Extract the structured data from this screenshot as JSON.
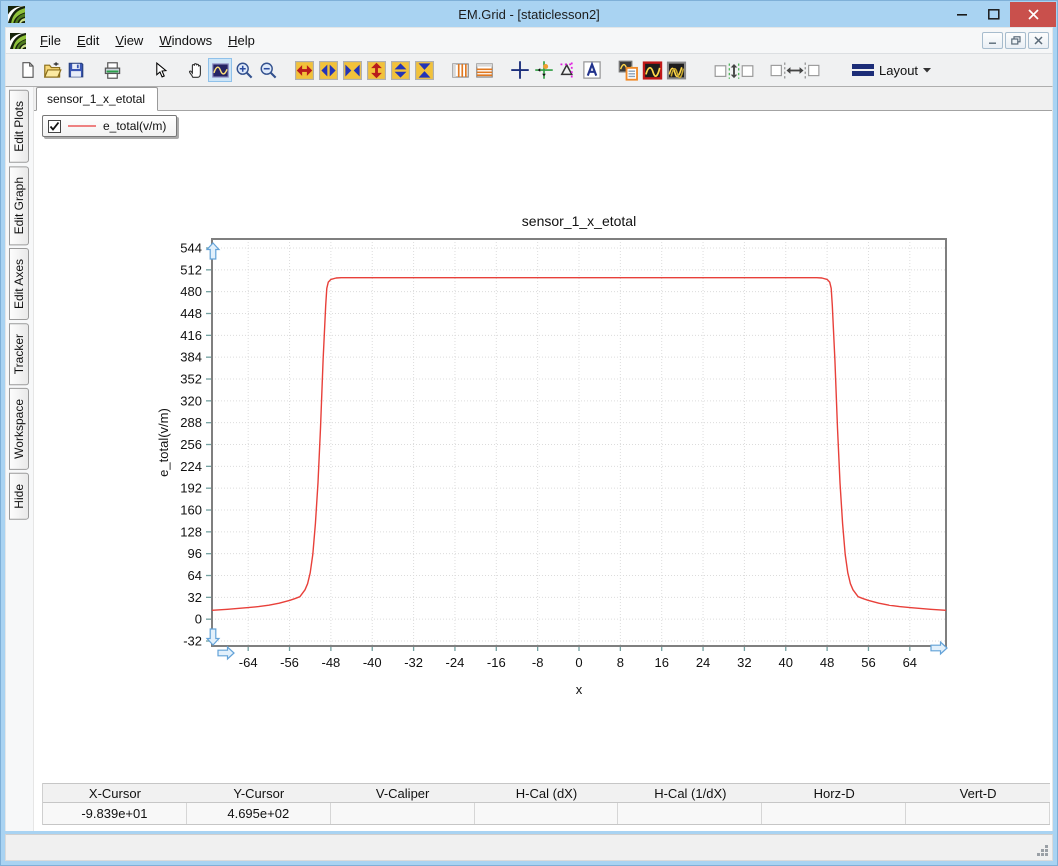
{
  "window": {
    "title": "EM.Grid - [staticlesson2]"
  },
  "menu": {
    "items": [
      "File",
      "Edit",
      "View",
      "Windows",
      "Help"
    ]
  },
  "toolbar": {
    "layout_label": "Layout"
  },
  "sidebar": {
    "tabs": [
      "Edit Plots",
      "Edit Graph",
      "Edit Axes",
      "Tracker",
      "Workspace",
      "Hide"
    ]
  },
  "document": {
    "tab_label": "sensor_1_x_etotal"
  },
  "legend": {
    "checked": true,
    "label": "e_total(v/m)",
    "sample_color": "#ee8181"
  },
  "status_table": {
    "columns": [
      "X-Cursor",
      "Y-Cursor",
      "V-Caliper",
      "H-Cal (dX)",
      "H-Cal (1/dX)",
      "Horz-D",
      "Vert-D"
    ],
    "values": [
      "-9.839e+01",
      "4.695e+02",
      "",
      "",
      "",
      "",
      ""
    ]
  },
  "colors": {
    "titlebar": "#a9d3f2",
    "close_button": "#c9504c",
    "selection": "#cde5f7",
    "curve": "#e8403a",
    "grid": "#dcdcdc",
    "tick": "#72a0a0",
    "plot_border": "#7f7f7f",
    "pan_arrow_fill": "#e2f0fb",
    "pan_arrow_stroke": "#63a2d8"
  },
  "chart_data": {
    "type": "line",
    "title": "sensor_1_x_etotal",
    "xlabel": "x",
    "ylabel": "e_total(v/m)",
    "xlim": [
      -71,
      71
    ],
    "ylim": [
      -39.3,
      557.2
    ],
    "x_ticks": [
      -64,
      -56,
      -48,
      -40,
      -32,
      -24,
      -16,
      -8,
      0,
      8,
      16,
      24,
      32,
      40,
      48,
      56,
      64
    ],
    "y_ticks": [
      544,
      512,
      480,
      448,
      416,
      384,
      352,
      320,
      288,
      256,
      224,
      192,
      160,
      128,
      96,
      64,
      32,
      0,
      -32
    ],
    "grid": true,
    "legend_position": "top-left",
    "series": [
      {
        "name": "e_total(v/m)",
        "color": "#e8403a",
        "x": [
          -71,
          -68,
          -64,
          -62,
          -60,
          -58,
          -56,
          -55,
          -54,
          -53,
          -52.5,
          -52,
          -51.5,
          -51,
          -50.5,
          -50,
          -49.5,
          -49,
          -48.8,
          -48.5,
          -48,
          -47,
          -46,
          -44,
          -40,
          -36,
          -32,
          -28,
          -24,
          -20,
          -16,
          -12,
          -8,
          -4,
          0,
          4,
          8,
          12,
          16,
          20,
          24,
          28,
          32,
          36,
          40,
          44,
          46,
          47,
          48,
          48.5,
          48.8,
          49,
          49.5,
          50,
          50.5,
          51,
          51.5,
          52,
          52.5,
          53,
          54,
          55,
          56,
          58,
          60,
          62,
          64,
          68,
          71
        ],
        "y": [
          13,
          14.5,
          17,
          18.5,
          20.5,
          23.5,
          27.5,
          30,
          33,
          43,
          52,
          68,
          95,
          140,
          200,
          280,
          380,
          460,
          485,
          494,
          498,
          500,
          500.5,
          500.5,
          500.5,
          500.5,
          500.5,
          500.5,
          500.5,
          500.5,
          500.5,
          500.5,
          500.5,
          500.5,
          500.5,
          500.5,
          500.5,
          500.5,
          500.5,
          500.5,
          500.5,
          500.5,
          500.5,
          500.5,
          500.5,
          500.5,
          500.5,
          500,
          498,
          494,
          485,
          460,
          380,
          280,
          200,
          140,
          95,
          68,
          52,
          43,
          33,
          30,
          27.5,
          23.5,
          20.5,
          18.5,
          17,
          14.5,
          13
        ]
      }
    ]
  }
}
